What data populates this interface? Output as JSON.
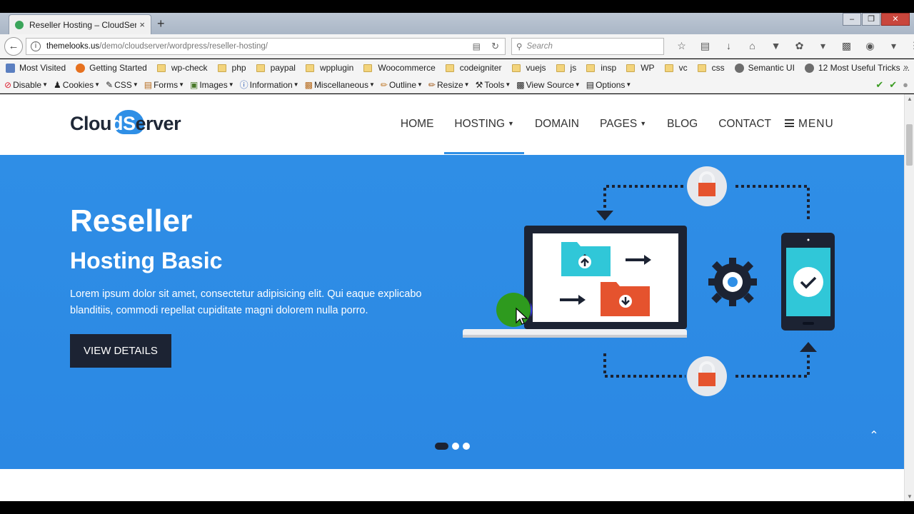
{
  "browser": {
    "tab_title": "Reseller Hosting – CloudServ",
    "tab_close": "×",
    "new_tab": "+",
    "window_buttons": [
      "–",
      "❐",
      "✕"
    ],
    "url_domain": "themelooks.us",
    "url_path": "/demo/cloudserver/wordpress/reseller-hosting/",
    "search_placeholder": "Search"
  },
  "bookmarks": [
    "Most Visited",
    "Getting Started",
    "wp-check",
    "php",
    "paypal",
    "wpplugin",
    "Woocommerce",
    "codeigniter",
    "vuejs",
    "js",
    "insp",
    "WP",
    "vc",
    "css",
    "Semantic UI",
    "12 Most Useful Tricks ..."
  ],
  "devtoolbar": [
    "Disable",
    "Cookies",
    "CSS",
    "Forms",
    "Images",
    "Information",
    "Miscellaneous",
    "Outline",
    "Resize",
    "Tools",
    "View Source",
    "Options"
  ],
  "site": {
    "logo_part1": "Clou",
    "logo_part2": "dS",
    "logo_part3": "erver",
    "nav": [
      {
        "label": "HOME",
        "dropdown": false
      },
      {
        "label": "HOSTING",
        "dropdown": true
      },
      {
        "label": "DOMAIN",
        "dropdown": false
      },
      {
        "label": "PAGES",
        "dropdown": true
      },
      {
        "label": "BLOG",
        "dropdown": false
      },
      {
        "label": "CONTACT",
        "dropdown": false
      }
    ],
    "menu_label": "MENU",
    "accent_color": "#2f8fe6",
    "dark_color": "#1c2333"
  },
  "hero": {
    "title": "Reseller",
    "subtitle": "Hosting Basic",
    "description": "Lorem ipsum dolor sit amet, consectetur adipisicing elit. Qui eaque explicabo blanditiis, commodi repellat cupiditate magni dolorem nulla porro.",
    "cta_label": "VIEW DETAILS",
    "slides_total": 3,
    "slide_active": 1
  }
}
